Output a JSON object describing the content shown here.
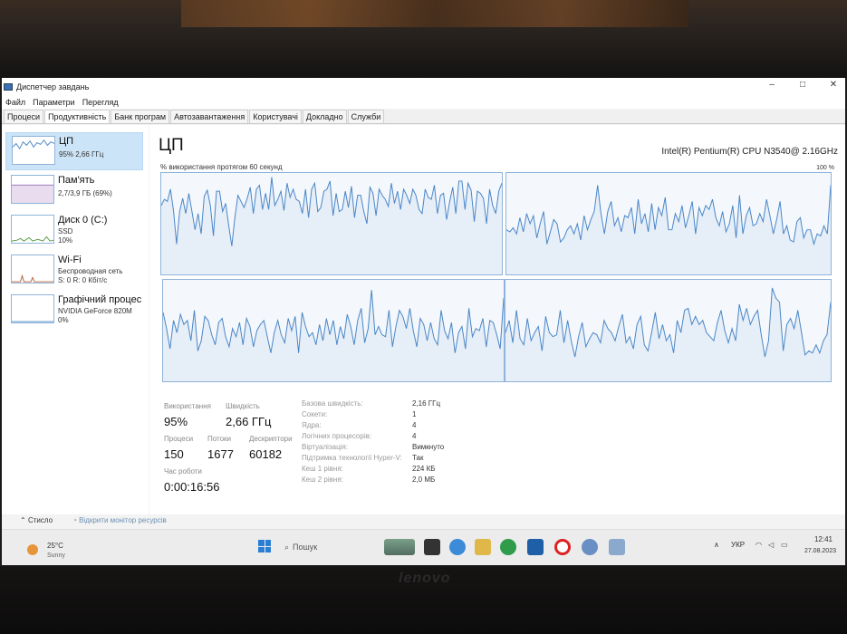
{
  "window": {
    "title": "Диспетчер завдань",
    "controls": [
      "–",
      "□",
      "✕"
    ]
  },
  "menu": [
    "Файл",
    "Параметри",
    "Перегляд"
  ],
  "tabs": [
    "Процеси",
    "Продуктивність",
    "Банк програм",
    "Автозавантаження",
    "Користувачі",
    "Докладно",
    "Служби"
  ],
  "sidebar": {
    "items": [
      {
        "name": "ЦП",
        "sub1": "95%  2,66 ГГц",
        "sub2": ""
      },
      {
        "name": "Пам'ять",
        "sub1": "2,7/3,9 ГБ (69%)",
        "sub2": ""
      },
      {
        "name": "Диск 0 (C:)",
        "sub1": "SSD",
        "sub2": "10%"
      },
      {
        "name": "Wi-Fi",
        "sub1": "Беспроводная сеть",
        "sub2": "S: 0 R: 0 Кбіт/с"
      },
      {
        "name": "Графічний процес",
        "sub1": "NVIDIA GeForce 820M",
        "sub2": "0%"
      }
    ]
  },
  "cpu": {
    "title": "ЦП",
    "model": "Intel(R) Pentium(R) CPU N3540@ 2.16GHz",
    "graph_label": "% використання протягом 60 секунд",
    "graph_max": "100 %",
    "core_usage": [
      [
        68,
        74,
        72,
        84,
        63,
        30,
        62,
        75,
        60,
        80,
        62,
        44,
        60,
        40,
        77,
        83,
        68,
        38,
        82,
        82,
        62,
        70,
        48,
        28,
        56,
        78,
        72,
        66,
        75,
        86,
        60,
        84,
        88,
        64,
        80,
        64,
        96,
        68,
        74,
        82,
        63,
        90,
        76,
        84,
        74,
        72,
        60,
        84,
        56,
        84,
        90,
        62,
        66,
        82,
        84,
        92,
        58,
        80,
        62,
        64,
        82,
        66,
        87,
        56,
        78,
        78,
        62,
        50,
        86,
        80,
        58,
        84,
        78,
        74,
        67,
        90,
        70,
        82,
        64,
        84,
        78,
        70,
        84,
        78,
        64,
        60,
        84,
        76,
        74,
        88,
        60,
        78,
        80,
        54,
        72,
        86,
        60,
        92,
        92,
        64,
        90,
        83,
        52,
        82,
        80,
        75,
        50,
        84,
        68,
        60,
        82,
        90
      ],
      [
        44,
        42,
        46,
        40,
        56,
        42,
        60,
        50,
        58,
        36,
        50,
        62,
        30,
        42,
        54,
        50,
        32,
        36,
        44,
        48,
        40,
        50,
        34,
        58,
        44,
        54,
        62,
        88,
        60,
        40,
        62,
        72,
        48,
        56,
        42,
        58,
        56,
        66,
        40,
        74,
        50,
        60,
        42,
        70,
        44,
        66,
        58,
        76,
        44,
        44,
        60,
        52,
        68,
        46,
        58,
        72,
        40,
        66,
        58,
        68,
        64,
        74,
        56,
        48,
        62,
        42,
        50,
        68,
        36,
        78,
        40,
        58,
        66,
        48,
        50,
        60,
        52,
        74,
        58,
        40,
        54,
        72,
        40,
        48,
        34,
        32,
        52,
        56,
        36,
        44,
        44,
        30,
        40,
        38,
        48,
        40,
        88
      ],
      [
        68,
        52,
        32,
        60,
        48,
        66,
        56,
        60,
        40,
        70,
        30,
        40,
        64,
        60,
        46,
        36,
        58,
        62,
        44,
        34,
        52,
        44,
        58,
        36,
        62,
        54,
        34,
        50,
        56,
        60,
        44,
        28,
        48,
        60,
        46,
        38,
        62,
        50,
        64,
        28,
        68,
        54,
        44,
        48,
        36,
        56,
        40,
        62,
        46,
        60,
        36,
        54,
        42,
        66,
        54,
        36,
        60,
        72,
        38,
        52,
        90,
        46,
        54,
        46,
        44,
        70,
        34,
        54,
        70,
        64,
        52,
        72,
        50,
        34,
        62,
        56,
        40,
        58,
        42,
        36,
        70,
        50,
        42,
        58,
        28,
        48,
        54,
        32,
        72,
        44,
        52,
        50,
        62,
        34,
        60,
        58,
        46,
        32,
        82
      ],
      [
        48,
        60,
        38,
        70,
        42,
        36,
        62,
        40,
        48,
        54,
        30,
        64,
        48,
        44,
        46,
        70,
        38,
        60,
        40,
        24,
        44,
        58,
        34,
        42,
        48,
        46,
        38,
        60,
        52,
        48,
        40,
        54,
        66,
        38,
        44,
        32,
        56,
        64,
        36,
        30,
        48,
        68,
        42,
        56,
        40,
        46,
        28,
        60,
        48,
        70,
        72,
        56,
        64,
        56,
        60,
        48,
        44,
        40,
        58,
        70,
        50,
        38,
        52,
        40,
        76,
        60,
        72,
        56,
        64,
        70,
        46,
        24,
        40,
        92,
        82,
        78,
        30,
        56,
        62,
        52,
        70,
        48,
        26,
        30,
        28,
        36,
        28,
        40,
        46,
        78
      ]
    ]
  },
  "stats": {
    "utilization_label": "Використання",
    "utilization_value": "95%",
    "speed_label": "Швидкість",
    "speed_value": "2,66 ГГц",
    "processes_label": "Процеси",
    "processes_value": "150",
    "threads_label": "Потоки",
    "threads_value": "1677",
    "handles_label": "Дескриптори",
    "handles_value": "60182",
    "uptime_label": "Час роботи",
    "uptime_value": "0:00:16:56"
  },
  "details": [
    {
      "label": "Базова швидкість:",
      "value": "2,16 ГГц"
    },
    {
      "label": "Сокети:",
      "value": "1"
    },
    {
      "label": "Ядра:",
      "value": "4"
    },
    {
      "label": "Логічних процесорів:",
      "value": "4"
    },
    {
      "label": "Віртуалізація:",
      "value": "Вимкнуто"
    },
    {
      "label": "Підтримка технології Hyper-V:",
      "value": "Так"
    },
    {
      "label": "Кеш 1 рівня:",
      "value": "224 КБ"
    },
    {
      "label": "Кеш 2 рівня:",
      "value": "2,0 МБ"
    }
  ],
  "footer": {
    "less": "Стисло",
    "monitor": "Відкрити монітор ресурсів"
  },
  "taskbar": {
    "weather_temp": "25°C",
    "weather_desc": "Sunny",
    "search": "Пошук",
    "lang": "УКР",
    "time": "12:41",
    "date": "27.08.2023"
  },
  "bezel": {
    "brand": "lenovo"
  },
  "colors": {
    "graph_line": "#4a86c8",
    "graph_fill": "#e6eef7",
    "graph_border": "#8fb3d9",
    "selected": "#cce4f7"
  }
}
